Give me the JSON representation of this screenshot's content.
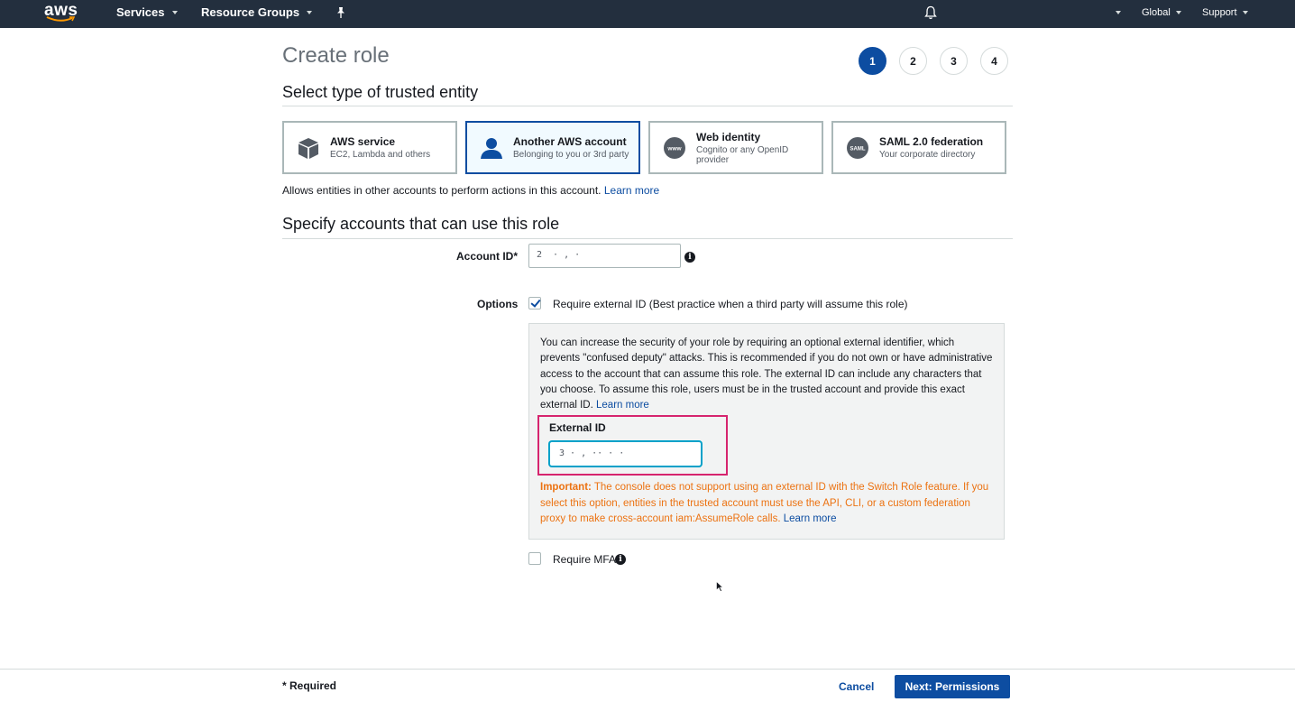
{
  "nav": {
    "logo": "aws",
    "services": "Services",
    "resource_groups": "Resource Groups",
    "region": "Global",
    "support": "Support"
  },
  "header": {
    "title": "Create role",
    "steps": [
      "1",
      "2",
      "3",
      "4"
    ],
    "active_step": "1"
  },
  "trusted_entity": {
    "heading": "Select type of trusted entity",
    "cards": [
      {
        "title": "AWS service",
        "subtitle": "EC2, Lambda and others",
        "icon": "cube-icon"
      },
      {
        "title": "Another AWS account",
        "subtitle": "Belonging to you or 3rd party",
        "icon": "user-icon",
        "selected": true
      },
      {
        "title": "Web identity",
        "subtitle": "Cognito or any OpenID provider",
        "icon": "www-icon"
      },
      {
        "title": "SAML 2.0 federation",
        "subtitle": "Your corporate directory",
        "icon": "saml-icon"
      }
    ],
    "description": "Allows entities in other accounts to perform actions in this account.",
    "learn_more": "Learn more"
  },
  "accounts": {
    "heading": "Specify accounts that can use this role",
    "account_id_label": "Account ID*",
    "account_id_value": "2 ‌‌  ·   ,‌ ·   ",
    "options_label": "Options",
    "require_external_id_label": "Require external ID (Best practice when a third party will assume this role)",
    "require_external_id_checked": true,
    "external_info": "You can increase the security of your role by requiring an optional external identifier, which prevents \"confused deputy\" attacks. This is recommended if you do not own or have administrative access to the account that can assume this role. The external ID can include any characters that you choose. To assume this role, users must be in the trusted account and provide this exact external ID.",
    "external_info_link": "Learn more",
    "external_id_label": "External ID",
    "external_id_value": "3 ·  ,  ·· ·   ·",
    "important_label": "Important:",
    "important_text": "The console does not support using an external ID with the Switch Role feature. If you select this option, entities in the trusted account must use the API, CLI, or a custom federation proxy to make cross-account iam:AssumeRole calls.",
    "important_link": "Learn more",
    "require_mfa_label": "Require MFA",
    "require_mfa_checked": false
  },
  "footer": {
    "required_note": "* Required",
    "cancel": "Cancel",
    "next": "Next: Permissions"
  },
  "colors": {
    "nav_bg": "#232f3e",
    "primary": "#0d4da1",
    "warning": "#ec7211",
    "highlight": "#d6246e"
  }
}
